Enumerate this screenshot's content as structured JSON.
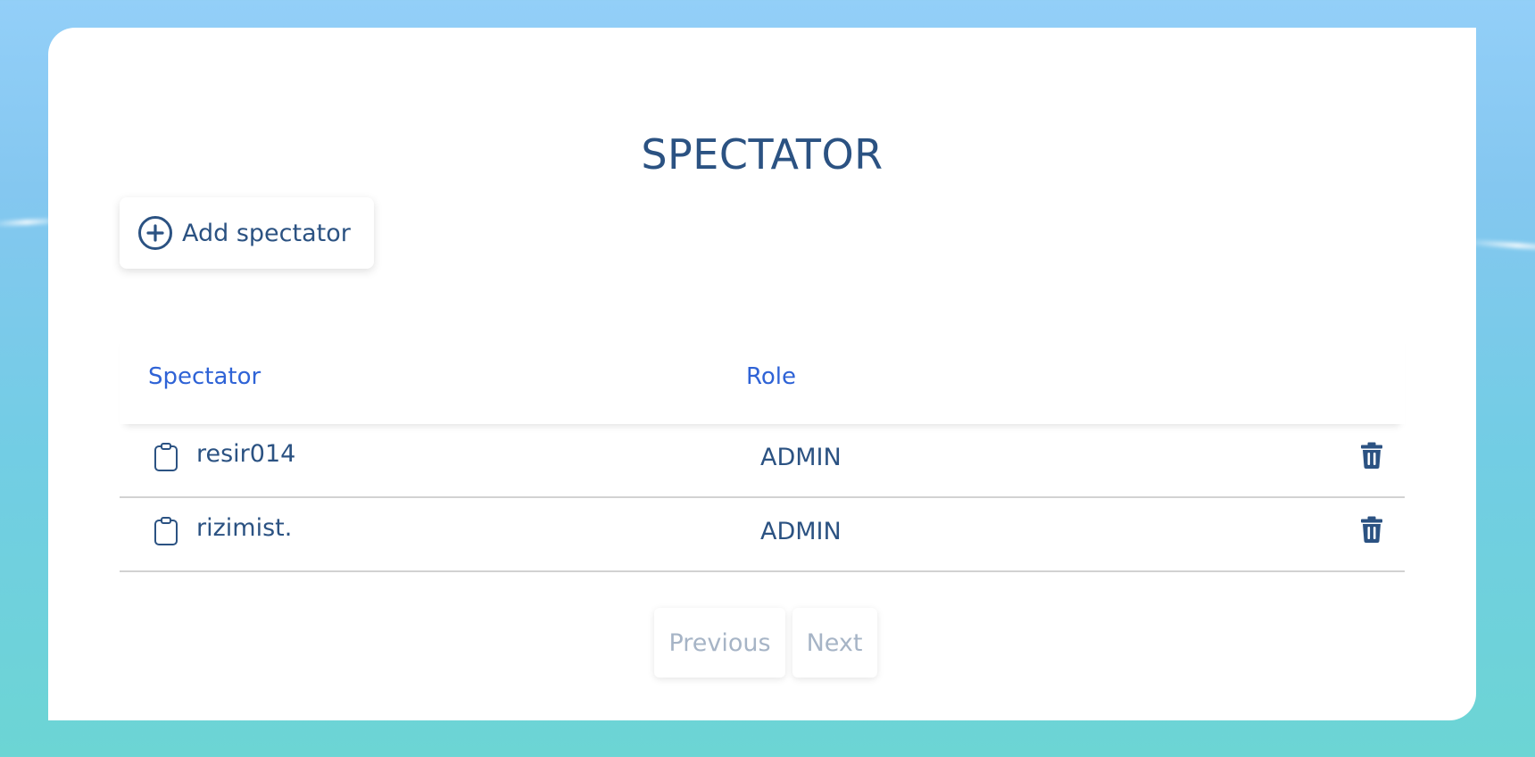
{
  "page": {
    "title": "SPECTATOR"
  },
  "toolbar": {
    "add_label": "Add spectator",
    "add_icon": "plus-circle-icon"
  },
  "table": {
    "columns": [
      "Spectator",
      "Role"
    ],
    "rows": [
      {
        "name": "resir014",
        "role": "ADMIN",
        "icon": "clipboard-icon",
        "action_icon": "trash-icon"
      },
      {
        "name": "rizimist.",
        "role": "ADMIN",
        "icon": "clipboard-icon",
        "action_icon": "trash-icon"
      }
    ]
  },
  "pagination": {
    "previous_label": "Previous",
    "next_label": "Next"
  },
  "colors": {
    "primary_text": "#2b5282",
    "header_text": "#2f63d6",
    "disabled_text": "#a6b4c6",
    "background_top": "#93cff8",
    "background_bottom": "#6cd5d4"
  }
}
